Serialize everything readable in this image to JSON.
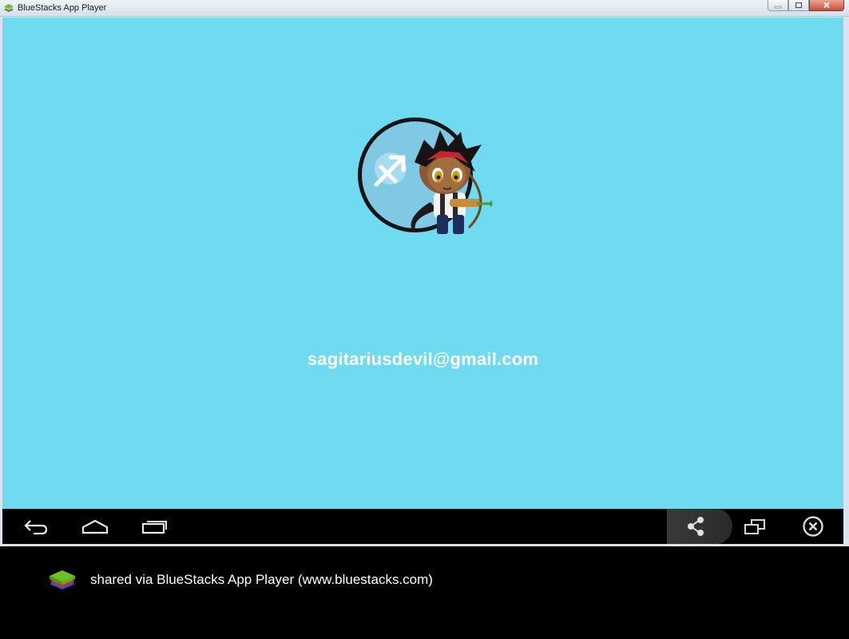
{
  "window": {
    "title": "BlueStacks App Player"
  },
  "screen": {
    "background": "#6fdaf0",
    "avatar_icon": "sagittarius-avatar",
    "email": "sagitariusdevil@gmail.com"
  },
  "navbar": {
    "back_icon": "back-arrow-icon",
    "home_icon": "home-icon",
    "recent_icon": "recent-apps-icon",
    "share_icon": "share-icon",
    "window_icon": "window-mode-icon",
    "close_icon": "close-circle-icon"
  },
  "footer": {
    "text": "shared via BlueStacks App Player (www.bluestacks.com)"
  }
}
